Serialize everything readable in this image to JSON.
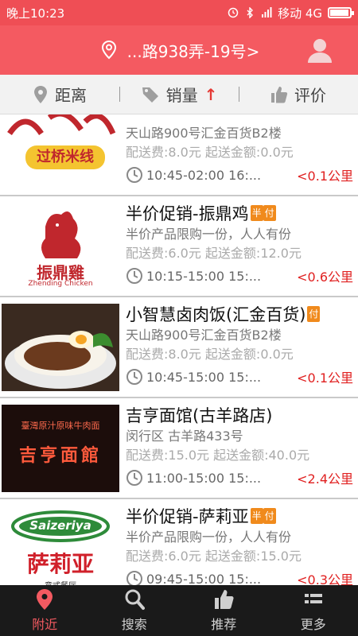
{
  "status": {
    "time": "晚上10:23",
    "carrier": "移动 4G",
    "battery_level": 0.9
  },
  "header": {
    "location": "...路938弄-19号>"
  },
  "sort": {
    "items": [
      {
        "label": "距离",
        "icon": "location-pin-icon"
      },
      {
        "label": "销量",
        "icon": "tag-icon",
        "arrow": "↑"
      },
      {
        "label": "评价",
        "icon": "thumbs-up-icon"
      }
    ]
  },
  "restaurants": [
    {
      "title": "",
      "sub": "天山路900号汇金百货B2楼",
      "fee": "配送费:8.0元 起送金额:0.0元",
      "hours": "10:45-02:00  16:...",
      "distance": "<0.1公里",
      "image_text": "过桥米线"
    },
    {
      "title": "半价促销-振鼎鸡",
      "badges": [
        "半",
        "付"
      ],
      "sub": "半价产品限购一份，人人有份",
      "fee": "配送费:6.0元 起送金额:12.0元",
      "hours": "10:15-15:00  15:...",
      "distance": "<0.6公里",
      "image_text": "振鼎雞",
      "image_subtext": "Zhending Chicken"
    },
    {
      "title": "小智慧卤肉饭(汇金百货)",
      "badges": [
        "付"
      ],
      "sub": "天山路900号汇金百货B2楼",
      "fee": "配送费:8.0元 起送金额:0.0元",
      "hours": "10:45-15:00  15:...",
      "distance": "<0.1公里"
    },
    {
      "title": "吉亨面馆(古羊路店)",
      "sub": "闵行区 古羊路433号",
      "fee": "配送费:15.0元 起送金额:40.0元",
      "hours": "11:00-15:00  15:...",
      "distance": "<2.4公里",
      "image_text": "吉亨面館",
      "image_subtext": "臺灣原汁原味牛肉面"
    },
    {
      "title": "半价促销-萨莉亚",
      "badges": [
        "半",
        "付"
      ],
      "sub": "半价产品限购一份，人人有份",
      "fee": "配送费:6.0元 起送金额:15.0元",
      "hours": "09:45-15:00  15:...",
      "distance": "<0.3公里",
      "image_text": "Saizeriya",
      "image_subtext": "萨莉亚",
      "image_subtext2": "意式餐厅"
    }
  ],
  "tabs": [
    {
      "label": "附近",
      "icon": "location-pin-icon",
      "active": true
    },
    {
      "label": "搜索",
      "icon": "search-icon"
    },
    {
      "label": "推荐",
      "icon": "thumbs-up-icon"
    },
    {
      "label": "更多",
      "icon": "more-icon"
    }
  ],
  "colors": {
    "brand": "#f45a61",
    "distance": "#e02020",
    "badge": "#f08a1c",
    "tabbar": "#1a1a1a"
  }
}
